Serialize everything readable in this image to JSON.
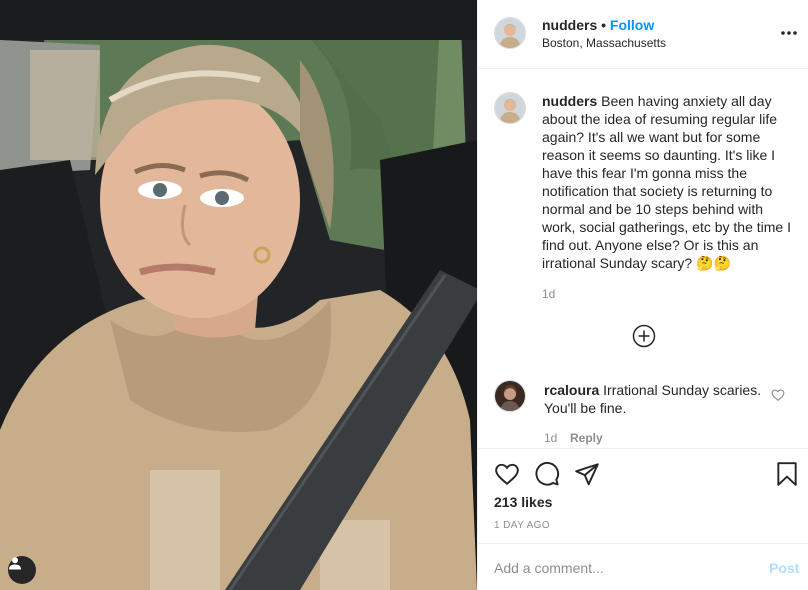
{
  "post": {
    "username": "nudders",
    "separator": "•",
    "follow_label": "Follow",
    "location": "Boston, Massachusetts"
  },
  "caption": {
    "username": "nudders",
    "text": "Been having anxiety all day about the idea of resuming regular life again? It's all we want but for some reason it seems so daunting. It's like I have this fear I'm gonna miss the notification that society is returning to normal and be 10 steps behind with work, social gatherings, etc by the time I find out. Anyone else? Or is this an irrational Sunday scary? 🤔🤔",
    "age": "1d"
  },
  "comments": [
    {
      "username": "rcaloura",
      "text": "Irrational Sunday scaries. You'll be fine.",
      "age": "1d",
      "reply_label": "Reply"
    }
  ],
  "stats": {
    "likes": "213 likes",
    "date": "1 DAY AGO"
  },
  "comment_box": {
    "placeholder": "Add a comment...",
    "post_label": "Post"
  },
  "colors": {
    "accent": "#0095f6",
    "post_disabled": "#b2dffc",
    "text": "#262626",
    "muted": "#8e8e8e"
  },
  "icons": [
    "more-options-icon",
    "load-more-comments-icon",
    "heart-icon",
    "comment-icon",
    "share-icon",
    "save-icon",
    "user-tag-icon"
  ]
}
